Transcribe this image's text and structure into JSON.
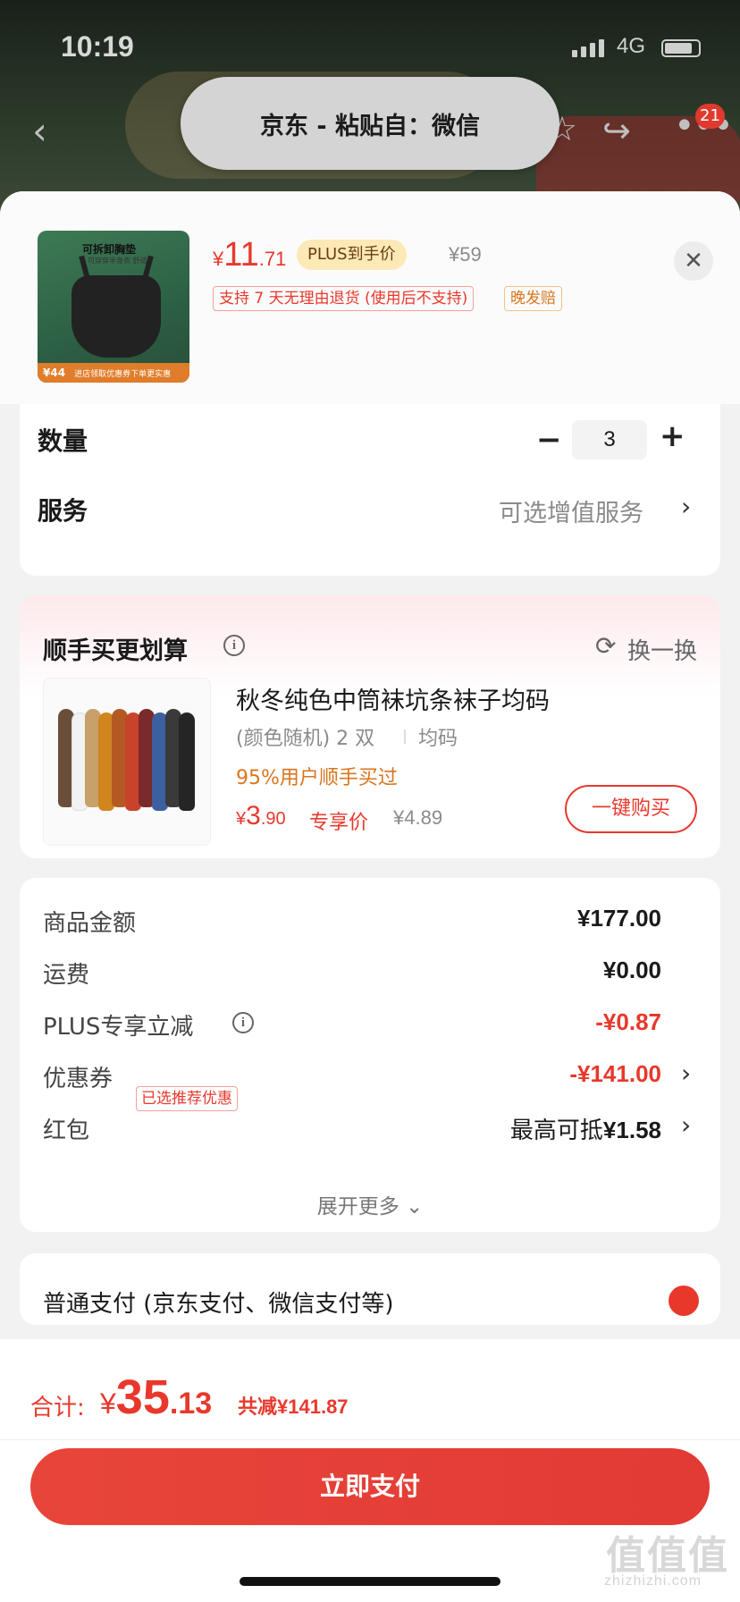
{
  "status_bar": {
    "time": "10:19",
    "network": "4G"
  },
  "nav": {
    "badge_count": "21",
    "back_icon": "back-arrow-icon",
    "share_icon": "share-icon",
    "more_icon": "more-icon"
  },
  "toast": {
    "text": "京东 - 粘贴自：微信"
  },
  "product": {
    "image_title": "可拆卸胸垫",
    "image_subtitle": "可穿穿半身衣 舒适",
    "image_band_price": "¥44",
    "image_band_text": "进店领取优惠券下单更实惠",
    "price_symbol": "¥",
    "price_int": "11",
    "price_dec": ".71",
    "plus_label": "PLUS到手价",
    "original_price": "¥59",
    "tag_return": "支持 7 天无理由退货 (使用后不支持)",
    "tag_late": "晚发赔"
  },
  "quantity": {
    "label": "数量",
    "value": "3",
    "minus": "−",
    "plus": "+"
  },
  "service": {
    "label": "服务",
    "value": "可选增值服务"
  },
  "addon": {
    "title": "顺手买更划算",
    "refresh_label": "换一换",
    "item": {
      "name": "秋冬纯色中筒袜坑条袜子均码",
      "spec": "(颜色随机) 2 双",
      "size": "均码",
      "rate": "95%用户顺手买过",
      "price_symbol": "¥",
      "price_int": "3",
      "price_dec": ".90",
      "exclusive_label": "专享价",
      "original_price": "¥4.89",
      "buy_label": "一键购买"
    },
    "sock_colors": [
      "#6b4e3a",
      "#f2f2f2",
      "#c7a06a",
      "#d0851f",
      "#b35a22",
      "#c9432c",
      "#7a2a2a",
      "#3c5fa0",
      "#3a3a3a",
      "#252525"
    ]
  },
  "summary": {
    "rows": [
      {
        "label": "商品金额",
        "value": "¥177.00"
      },
      {
        "label": "运费",
        "value": "¥0.00"
      },
      {
        "label": "PLUS专享立减",
        "value": "-¥0.87"
      },
      {
        "label": "优惠券",
        "tag": "已选推荐优惠",
        "value": "-¥141.00"
      },
      {
        "label": "红包",
        "value_prefix": "最高可抵",
        "value": "¥1.58"
      }
    ],
    "expand_label": "展开更多"
  },
  "payment": {
    "text": "普通支付 (京东支付、微信支付等)"
  },
  "bottom": {
    "total_label": "合计:",
    "total_symbol": "¥",
    "total_int": "35",
    "total_dec": ".13",
    "save_prefix": "共减",
    "save_value": "¥141.87",
    "pay_button": "立即支付"
  },
  "watermark": {
    "text": "值值值",
    "sub": "zhizhizhi.com"
  },
  "colors": {
    "accent": "#e8382c",
    "plus_bg": "#fde9b5",
    "orange": "#d9761e"
  }
}
